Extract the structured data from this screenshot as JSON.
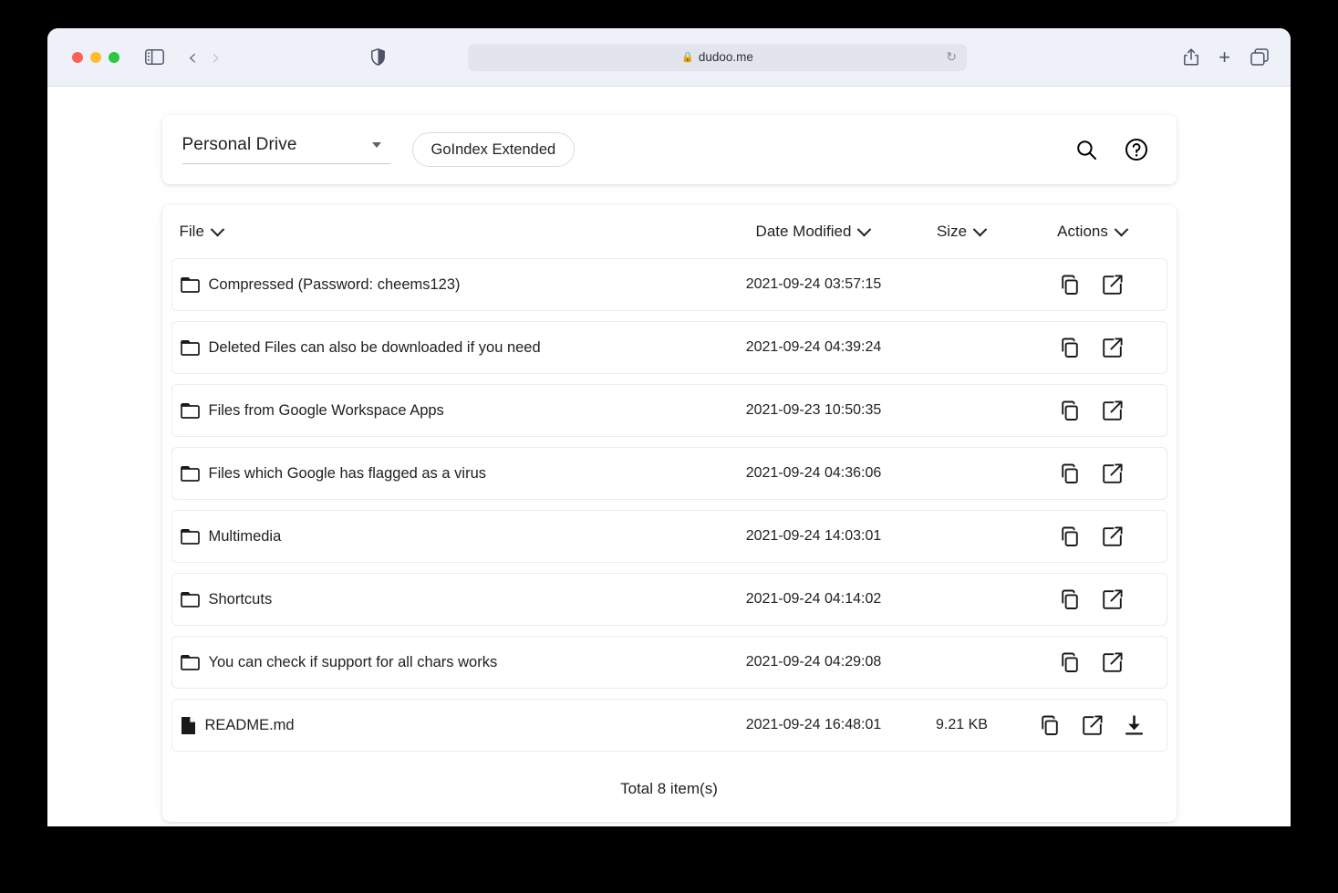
{
  "browser": {
    "url": "dudoo.me",
    "lock_icon": "lock-icon",
    "reload_icon": "reload-icon",
    "sidebar_icon": "sidebar-toggle-icon",
    "back_icon": "back-arrow-icon",
    "forward_icon": "forward-arrow-icon",
    "shield_icon": "privacy-shield-icon",
    "share_icon": "share-icon",
    "new_tab_icon": "plus-icon",
    "tabs_icon": "tab-overview-icon"
  },
  "header": {
    "drive_label": "Personal Drive",
    "dropdown_icon": "chevron-down-icon",
    "app_button": "GoIndex Extended",
    "search_icon": "search-icon",
    "help_icon": "help-circle-icon"
  },
  "table": {
    "columns": [
      {
        "label": "File",
        "sort_icon": "chevron-down-icon"
      },
      {
        "label": "Date Modified",
        "sort_icon": "chevron-down-icon"
      },
      {
        "label": "Size",
        "sort_icon": "chevron-down-icon"
      },
      {
        "label": "Actions",
        "sort_icon": "chevron-down-icon"
      }
    ],
    "rows": [
      {
        "icon": "folder-icon",
        "name": "Compressed (Password: cheems123)",
        "date": "2021-09-24 03:57:15",
        "size": "",
        "actions": [
          "copy-icon",
          "open-in-new-icon"
        ]
      },
      {
        "icon": "folder-icon",
        "name": "Deleted Files can also be downloaded if you need",
        "date": "2021-09-24 04:39:24",
        "size": "",
        "actions": [
          "copy-icon",
          "open-in-new-icon"
        ]
      },
      {
        "icon": "folder-icon",
        "name": "Files from Google Workspace Apps",
        "date": "2021-09-23 10:50:35",
        "size": "",
        "actions": [
          "copy-icon",
          "open-in-new-icon"
        ]
      },
      {
        "icon": "folder-icon",
        "name": "Files which Google has flagged as a virus",
        "date": "2021-09-24 04:36:06",
        "size": "",
        "actions": [
          "copy-icon",
          "open-in-new-icon"
        ]
      },
      {
        "icon": "folder-icon",
        "name": "Multimedia",
        "date": "2021-09-24 14:03:01",
        "size": "",
        "actions": [
          "copy-icon",
          "open-in-new-icon"
        ]
      },
      {
        "icon": "folder-icon",
        "name": "Shortcuts",
        "date": "2021-09-24 04:14:02",
        "size": "",
        "actions": [
          "copy-icon",
          "open-in-new-icon"
        ]
      },
      {
        "icon": "folder-icon",
        "name": "You can check if support for all chars works",
        "date": "2021-09-24 04:29:08",
        "size": "",
        "actions": [
          "copy-icon",
          "open-in-new-icon"
        ]
      },
      {
        "icon": "file-icon",
        "name": "README.md",
        "date": "2021-09-24 16:48:01",
        "size": "9.21 KB",
        "actions": [
          "copy-icon",
          "open-in-new-icon",
          "download-icon"
        ]
      }
    ],
    "total_label": "Total 8 item(s)"
  },
  "colors": {
    "traffic_red": "#ff5f57",
    "traffic_yellow": "#febc2e",
    "traffic_green": "#28c840",
    "toolbar_bg": "#eef1f8",
    "page_bg": "#ffffff",
    "text": "#202124"
  }
}
